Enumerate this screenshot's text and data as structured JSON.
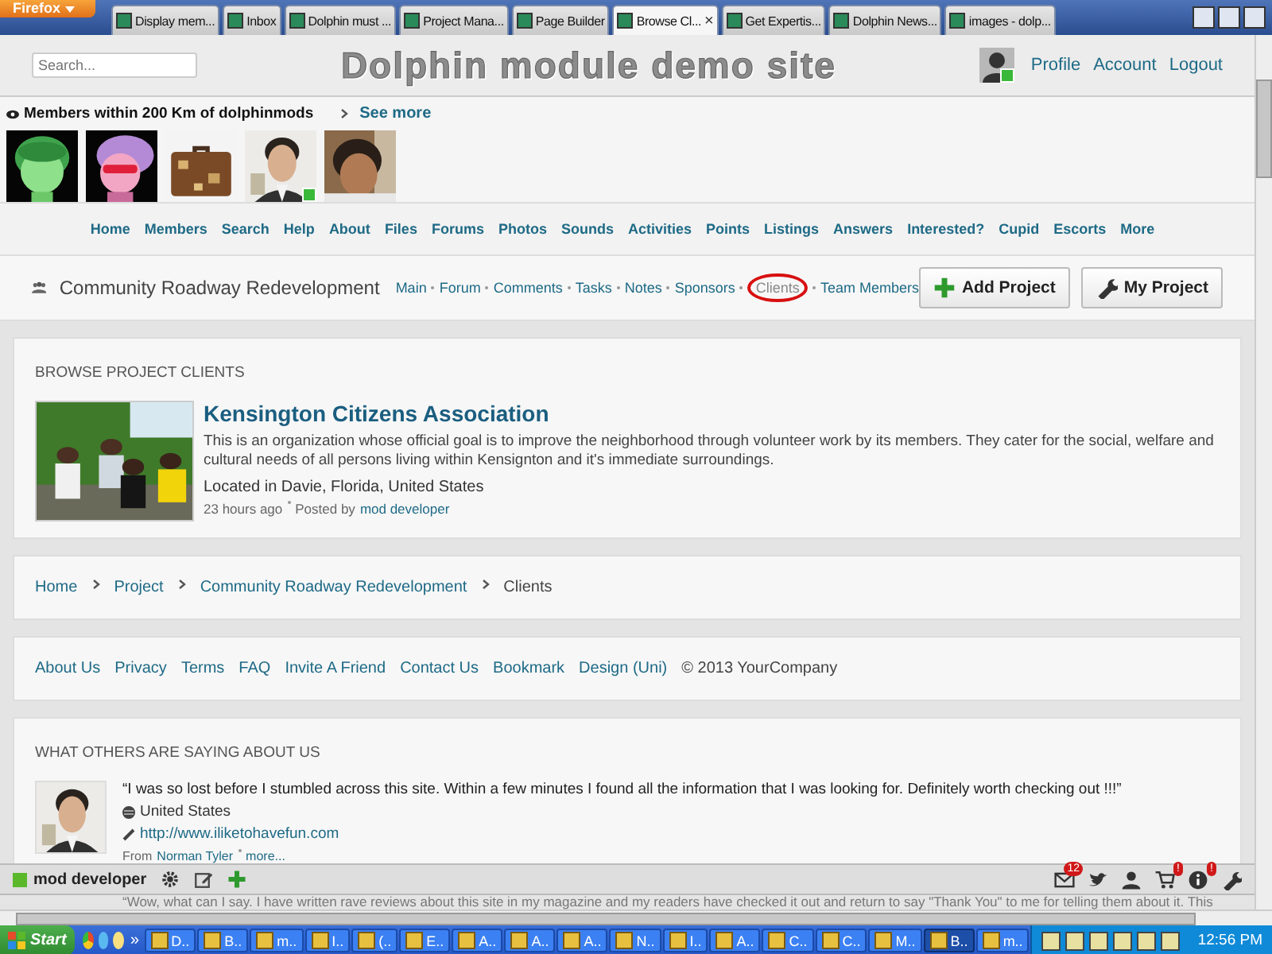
{
  "browser": {
    "menu_button": "Firefox",
    "tabs": [
      {
        "label": "Display mem...",
        "selected": false
      },
      {
        "label": "Inbox",
        "selected": false
      },
      {
        "label": "Dolphin must ...",
        "selected": false
      },
      {
        "label": "Project Mana...",
        "selected": false
      },
      {
        "label": "Page Builder",
        "selected": false
      },
      {
        "label": "Browse Cl...",
        "selected": true,
        "close": "×"
      },
      {
        "label": "Get Expertis...",
        "selected": false
      },
      {
        "label": "Dolphin News...",
        "selected": false
      },
      {
        "label": "images - dolp...",
        "selected": false
      }
    ]
  },
  "header": {
    "search": {
      "placeholder": "Search..."
    },
    "site_title": "Dolphin module demo site",
    "avatar_online": true,
    "user_links": [
      "Profile",
      "Account",
      "Logout"
    ]
  },
  "members": {
    "title": "Members within 200 Km of dolphinmods",
    "see_more": "See more",
    "avatars": [
      {
        "online": false
      },
      {
        "online": false
      },
      {
        "online": false
      },
      {
        "online": true
      },
      {
        "online": false
      }
    ]
  },
  "nav": [
    "Home",
    "Members",
    "Search",
    "Help",
    "About",
    "Files",
    "Forums",
    "Photos",
    "Sounds",
    "Activities",
    "Points",
    "Listings",
    "Answers",
    "Interested?",
    "Cupid",
    "Escorts",
    "More"
  ],
  "project": {
    "title": "Community Roadway Redevelopment",
    "links": [
      {
        "label": "Main",
        "selected": false
      },
      {
        "label": "Forum",
        "selected": false
      },
      {
        "label": "Comments",
        "selected": false
      },
      {
        "label": "Tasks",
        "selected": false
      },
      {
        "label": "Notes",
        "selected": false
      },
      {
        "label": "Sponsors",
        "selected": false
      },
      {
        "label": "Clients",
        "selected": true
      },
      {
        "label": "Team Members",
        "selected": false
      }
    ],
    "buttons": [
      {
        "kind": "add",
        "label": "Add Project"
      },
      {
        "kind": "tool",
        "label": "My Project"
      }
    ]
  },
  "clients": {
    "heading": "BROWSE PROJECT CLIENTS",
    "items": [
      {
        "title": "Kensington Citizens Association",
        "description": "This is an organization whose official goal is to improve the neighborhood through volunteer work by its members. They cater for the social, welfare and cultural needs of all persons living within Kensignton and it's immediate surroundings.",
        "location": "Located in Davie, Florida, United States",
        "time": "23 hours ago",
        "posted_by": "Posted by",
        "author": "mod developer"
      }
    ]
  },
  "breadcrumb": [
    "Home",
    "Project",
    "Community Roadway Redevelopment",
    "Clients"
  ],
  "footer": {
    "links": [
      "About Us",
      "Privacy",
      "Terms",
      "FAQ",
      "Invite A Friend",
      "Contact Us",
      "Bookmark",
      "Design (Uni)"
    ],
    "copyright": "© 2013 YourCompany"
  },
  "testimonials": {
    "heading": "WHAT OTHERS ARE SAYING ABOUT US",
    "items": [
      {
        "quote": "“I was so lost before I stumbled across this site. Within a few minutes I found all the information that I was looking for. Definitely worth checking out !!!”",
        "country": "United States",
        "url": "http://www.iliketohavefun.com",
        "from": "From",
        "author": "Norman Tyler",
        "more": "more..."
      }
    ],
    "next_quote": "“Wow, what can I say. I have written rave reviews about this site in my magazine and my readers have checked it out and return to say \"Thank You\" to me for telling them about it. This"
  },
  "toolbar": {
    "user": "mod developer",
    "left_icons": [
      {
        "kind": "gear"
      },
      {
        "kind": "edit"
      },
      {
        "kind": "plus"
      }
    ],
    "right_icons": [
      {
        "kind": "mail",
        "badge": "12"
      },
      {
        "kind": "bird"
      },
      {
        "kind": "person"
      },
      {
        "kind": "cart",
        "badge": "!"
      },
      {
        "kind": "info",
        "badge": "!"
      },
      {
        "kind": "wrench"
      }
    ]
  },
  "taskbar": {
    "start": "Start",
    "more": "»",
    "tasks": [
      {
        "label": "D..",
        "selected": false
      },
      {
        "label": "B..",
        "selected": false
      },
      {
        "label": "m..",
        "selected": false
      },
      {
        "label": "I..",
        "selected": false
      },
      {
        "label": "(..",
        "selected": false
      },
      {
        "label": "E..",
        "selected": false
      },
      {
        "label": "A..",
        "selected": false
      },
      {
        "label": "A..",
        "selected": false
      },
      {
        "label": "A..",
        "selected": false
      },
      {
        "label": "N..",
        "selected": false
      },
      {
        "label": "I..",
        "selected": false
      },
      {
        "label": "A..",
        "selected": false
      },
      {
        "label": "C..",
        "selected": false
      },
      {
        "label": "C..",
        "selected": false
      },
      {
        "label": "M..",
        "selected": false
      },
      {
        "label": "B..",
        "selected": true
      },
      {
        "label": "m..",
        "selected": false
      }
    ],
    "clock": "12:56 PM"
  }
}
